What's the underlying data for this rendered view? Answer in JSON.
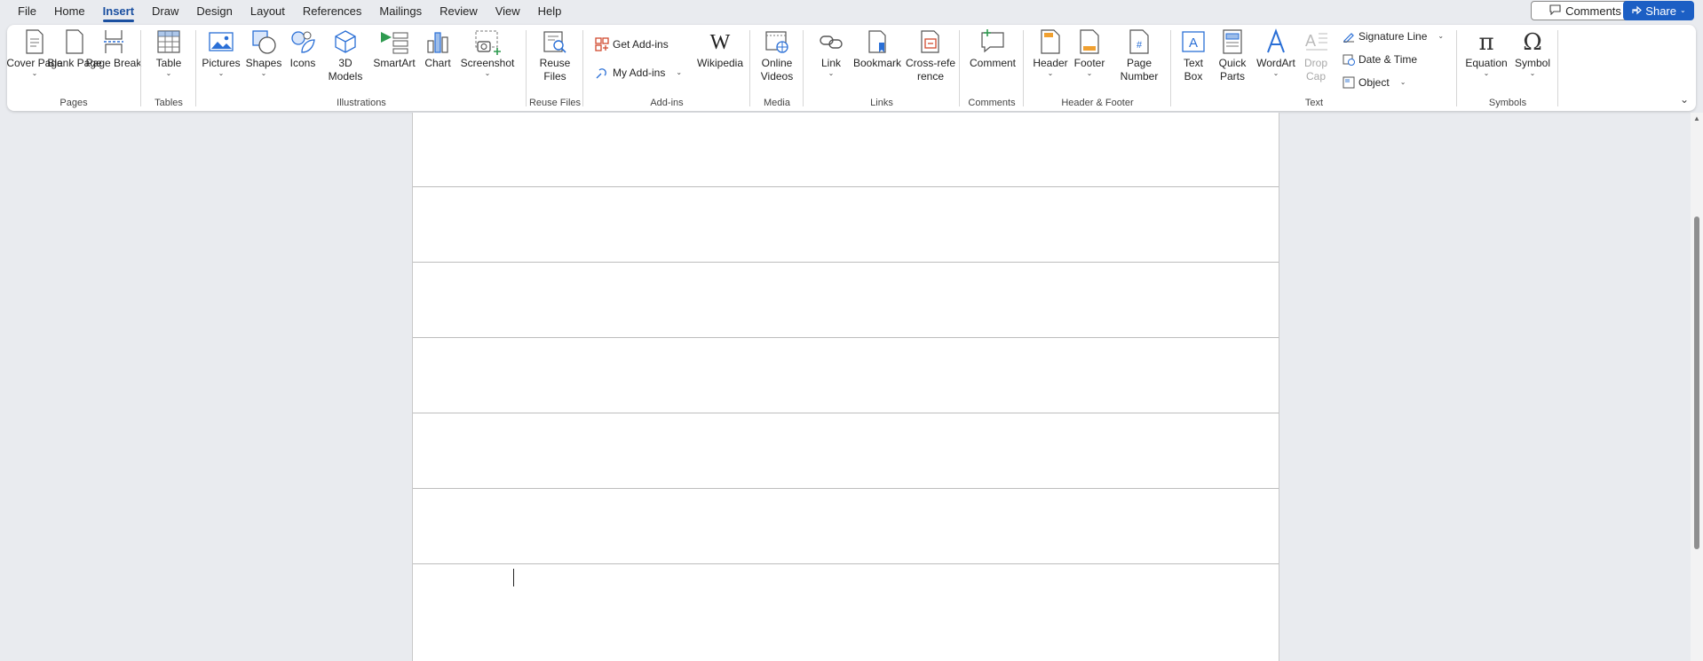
{
  "menu": {
    "tabs": [
      "File",
      "Home",
      "Insert",
      "Draw",
      "Design",
      "Layout",
      "References",
      "Mailings",
      "Review",
      "View",
      "Help"
    ],
    "active_tab": "Insert",
    "comments_label": "Comments",
    "share_label": "Share"
  },
  "ribbon": {
    "pages": {
      "label": "Pages",
      "cover_page": "Cover Page",
      "blank_page": "Blank Page",
      "page_break": "Page Break"
    },
    "tables": {
      "label": "Tables",
      "table": "Table"
    },
    "illustrations": {
      "label": "Illustrations",
      "pictures": "Pictures",
      "shapes": "Shapes",
      "icons": "Icons",
      "models_3d": "3D Models",
      "smartart": "SmartArt",
      "chart": "Chart",
      "screenshot": "Screenshot"
    },
    "reuse": {
      "label": "Reuse Files",
      "reuse_files": "Reuse Files"
    },
    "addins": {
      "label": "Add-ins",
      "get_addins": "Get Add-ins",
      "my_addins": "My Add-ins",
      "wikipedia": "Wikipedia"
    },
    "media": {
      "label": "Media",
      "online_videos": "Online Videos"
    },
    "links": {
      "label": "Links",
      "link": "Link",
      "bookmark": "Bookmark",
      "cross_reference": "Cross-reference"
    },
    "comments": {
      "label": "Comments",
      "comment": "Comment"
    },
    "header_footer": {
      "label": "Header & Footer",
      "header": "Header",
      "footer": "Footer",
      "page_number": "Page Number"
    },
    "text": {
      "label": "Text",
      "text_box": "Text Box",
      "quick_parts": "Quick Parts",
      "wordart": "WordArt",
      "drop_cap": "Drop Cap",
      "signature_line": "Signature Line",
      "date_time": "Date & Time",
      "object": "Object"
    },
    "symbols": {
      "label": "Symbols",
      "equation": "Equation",
      "symbol": "Symbol"
    }
  },
  "colors": {
    "accent": "#1a4fa0",
    "share_bg": "#1c5fc4",
    "background": "#e9ebef"
  }
}
